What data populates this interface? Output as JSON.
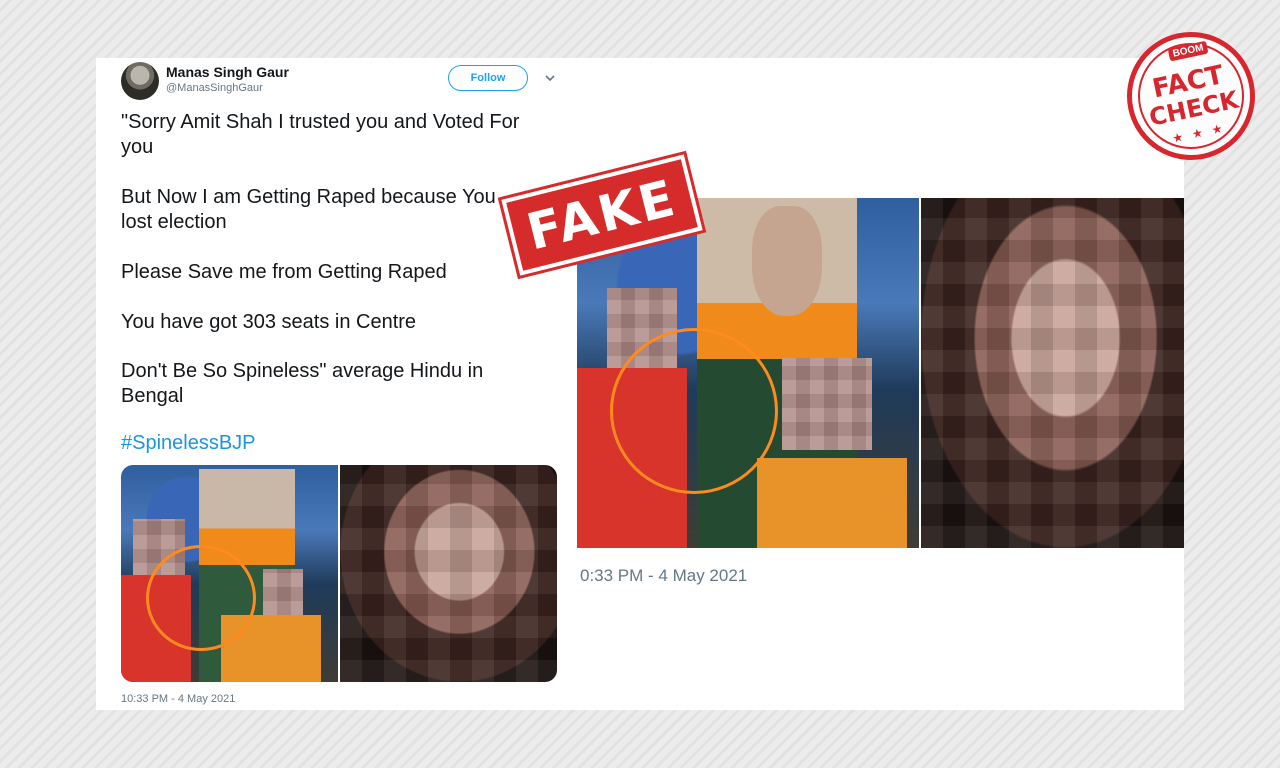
{
  "tweet": {
    "author_name": "Manas Singh Gaur",
    "author_handle": "@ManasSinghGaur",
    "follow_label": "Follow",
    "lines": [
      "\"Sorry Amit Shah I trusted you and Voted For",
      "you",
      "But Now I am Getting Raped because You",
      "lost election",
      "Please Save me from Getting Raped",
      "You have got 303 seats in Centre",
      "Don't Be So Spineless\" average Hindu in",
      "Bengal"
    ],
    "hashtag": "#SpinelessBJP",
    "timestamp_small": "10:33 PM - 4 May 2021",
    "timestamp_large": "0:33 PM - 4 May 2021"
  },
  "stamps": {
    "fake": "FAKE",
    "boom": "BOOM",
    "fact": "FACT",
    "check": "CHECK",
    "stars": "★ ★ ★"
  },
  "colors": {
    "accent": "#1da1f2",
    "hashtag": "#1b95e0",
    "stamp_red": "#d62b2b",
    "circle": "#ff8a1f"
  },
  "icons": {
    "chevron": "chevron-down-icon"
  }
}
